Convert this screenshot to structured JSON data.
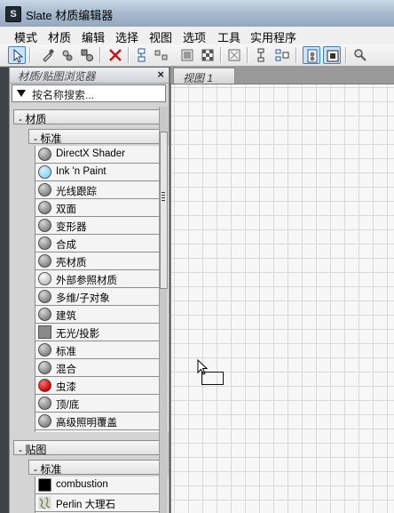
{
  "window": {
    "title": "Slate 材质编辑器",
    "icon": "3dsmax-logo-icon"
  },
  "menu": [
    "模式",
    "材质",
    "编辑",
    "选择",
    "视图",
    "选项",
    "工具",
    "实用程序"
  ],
  "toolbar": {
    "buttons": [
      "select-arrow-icon",
      "eyedropper-icon",
      "pick-material-icon",
      "put-to-scene-icon",
      "delete-icon",
      "layout-icon",
      "layout-children-icon",
      "node-icon",
      "checker-icon",
      "background-icon",
      "move-children-icon",
      "hide-slots-icon",
      "show-map-icon",
      "show-end-result-icon",
      "search-node-icon"
    ]
  },
  "browser": {
    "title": "材质/贴图浏览器",
    "close": "×",
    "search_placeholder": "按名称搜索...",
    "materials_group": "- 材质",
    "standard_subgroup": "- 标准",
    "materials": [
      {
        "label": "DirectX Shader",
        "swatch": "gray-sphere"
      },
      {
        "label": "Ink 'n Paint",
        "swatch": "light-blue-sphere"
      },
      {
        "label": "光线跟踪",
        "swatch": "gray-sphere"
      },
      {
        "label": "双面",
        "swatch": "gray-sphere"
      },
      {
        "label": "变形器",
        "swatch": "gray-sphere"
      },
      {
        "label": "合成",
        "swatch": "gray-sphere"
      },
      {
        "label": "壳材质",
        "swatch": "gray-sphere"
      },
      {
        "label": "外部参照材质",
        "swatch": "white-sphere"
      },
      {
        "label": "多维/子对象",
        "swatch": "gray-sphere"
      },
      {
        "label": "建筑",
        "swatch": "gray-sphere"
      },
      {
        "label": "无光/投影",
        "swatch": "gray-square"
      },
      {
        "label": "标准",
        "swatch": "gray-sphere"
      },
      {
        "label": "混合",
        "swatch": "gray-sphere"
      },
      {
        "label": "虫漆",
        "swatch": "red-sphere"
      },
      {
        "label": "顶/底",
        "swatch": "gray-sphere"
      },
      {
        "label": "高级照明覆盖",
        "swatch": "gray-sphere"
      }
    ],
    "maps_group": "- 贴图",
    "maps_subgroup": "- 标准",
    "maps": [
      {
        "label": "combustion",
        "swatch": "black-square"
      },
      {
        "label": "Perlin 大理石",
        "swatch": "marble-texture"
      }
    ]
  },
  "view": {
    "tab_label": "视图 1"
  },
  "colors": {
    "accent": "#3d7fc2",
    "titlebar": "#a9bccf",
    "sphere": "#7d7d7d",
    "red": "#c40000",
    "lightblue": "#8fd0f0"
  }
}
